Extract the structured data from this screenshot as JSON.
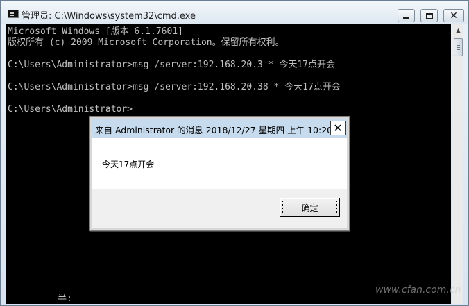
{
  "window": {
    "title": "管理员: C:\\Windows\\system32\\cmd.exe",
    "icon": "console-icon"
  },
  "console": {
    "lines": [
      "Microsoft Windows [版本 6.1.7601]",
      "版权所有 (c) 2009 Microsoft Corporation。保留所有权利。",
      "C:\\Users\\Administrator>msg /server:192.168.20.3 * 今天17点开会",
      "C:\\Users\\Administrator>msg /server:192.168.20.38 * 今天17点开会",
      "C:\\Users\\Administrator>"
    ],
    "ime_status": "半:"
  },
  "dialog": {
    "title": "来自 Administrator 的消息 2018/12/27 星期四 上午 10:20",
    "message": "今天17点开会",
    "ok_label": "确定",
    "close_label": "✕"
  },
  "watermark": "www.cfan.com.cn",
  "colors": {
    "console_bg": "#000000",
    "console_text": "#c0c0c0",
    "dialog_title_bg": "#c7dbef"
  }
}
